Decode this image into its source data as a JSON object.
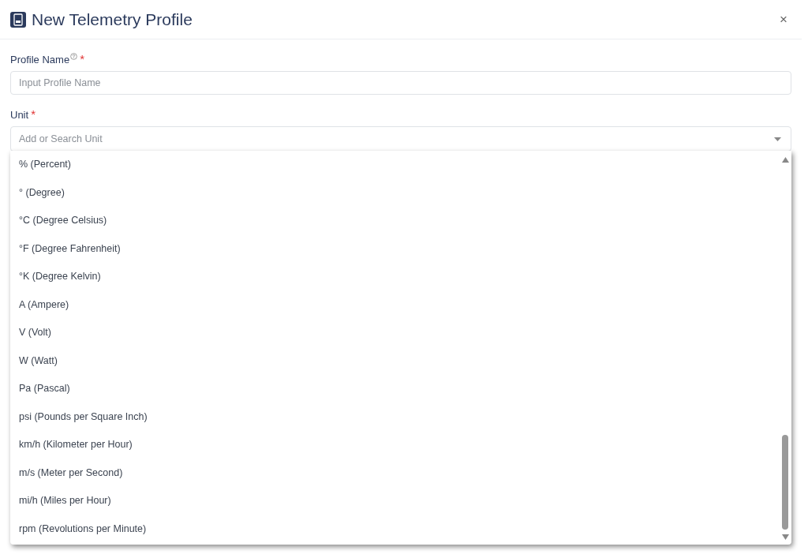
{
  "dialog": {
    "title": "New Telemetry Profile",
    "close": "×"
  },
  "fields": [
    {
      "kind": "text",
      "label": "Profile Name",
      "required_mark": "*",
      "help": true,
      "placeholder": "Input Profile Name"
    },
    {
      "kind": "select",
      "label": "Unit",
      "required_mark": "*",
      "help": false,
      "placeholder": "Add or Search Unit",
      "expanded": true
    }
  ],
  "unit_options": [
    {
      "label": "% (Percent)"
    },
    {
      "label": "° (Degree)"
    },
    {
      "label": "°C (Degree Celsius)"
    },
    {
      "label": "°F (Degree Fahrenheit)"
    },
    {
      "label": "°K (Degree Kelvin)"
    },
    {
      "label": "A (Ampere)"
    },
    {
      "label": "V (Volt)"
    },
    {
      "label": "W (Watt)"
    },
    {
      "label": "Pa (Pascal)"
    },
    {
      "label": "psi (Pounds per Square Inch)"
    },
    {
      "label": "km/h (Kilometer per Hour)"
    },
    {
      "label": "m/s (Meter per Second)"
    },
    {
      "label": "mi/h (Miles per Hour)"
    },
    {
      "label": "rpm (Revolutions per Minute)"
    }
  ]
}
